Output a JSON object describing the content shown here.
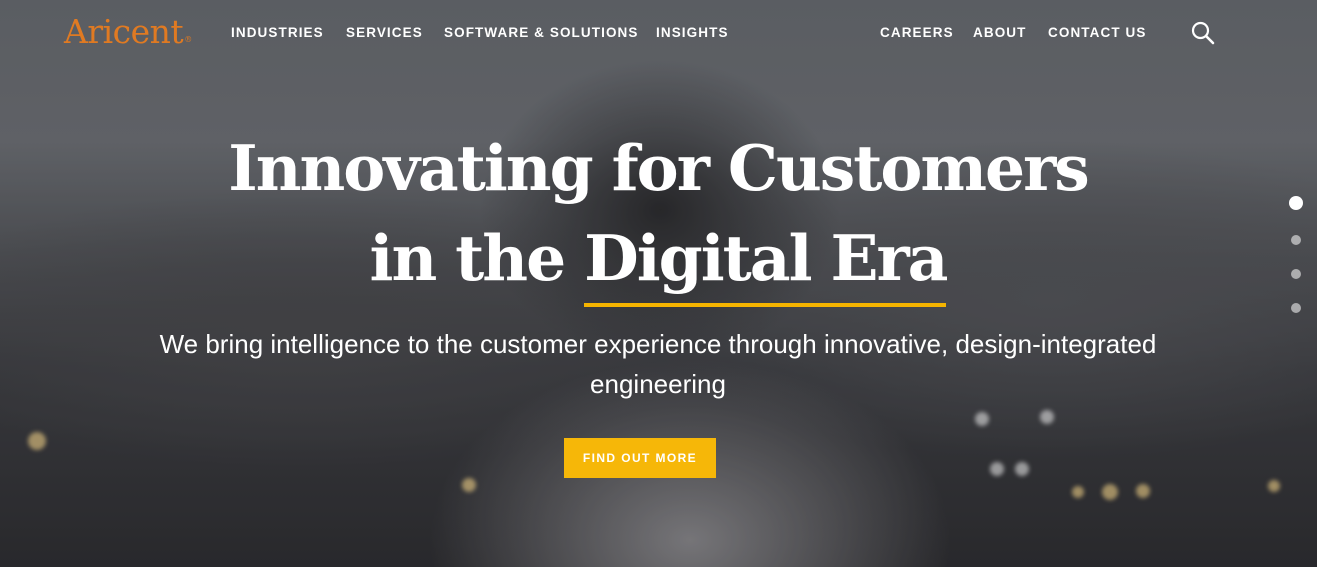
{
  "brand": {
    "logo_text": "Aricent",
    "logo_mark": "®",
    "color": "#e07a22"
  },
  "nav": {
    "left_items": [
      "INDUSTRIES",
      "SERVICES",
      "SOFTWARE & SOLUTIONS",
      "INSIGHTS"
    ],
    "right_items": [
      "CAREERS",
      "ABOUT",
      "CONTACT US"
    ],
    "search_icon": "search-icon"
  },
  "hero": {
    "headline_line1": "Innovating for Customers",
    "headline_line2_pre": "in the ",
    "headline_line2_highlight": "Digital Era",
    "subtext": "We bring intelligence to the customer experience through innovative, design-integrated engineering",
    "cta_label": "FIND OUT MORE",
    "accent_color": "#f6b708"
  },
  "carousel": {
    "slide_count": 4,
    "active_slide": 1
  }
}
